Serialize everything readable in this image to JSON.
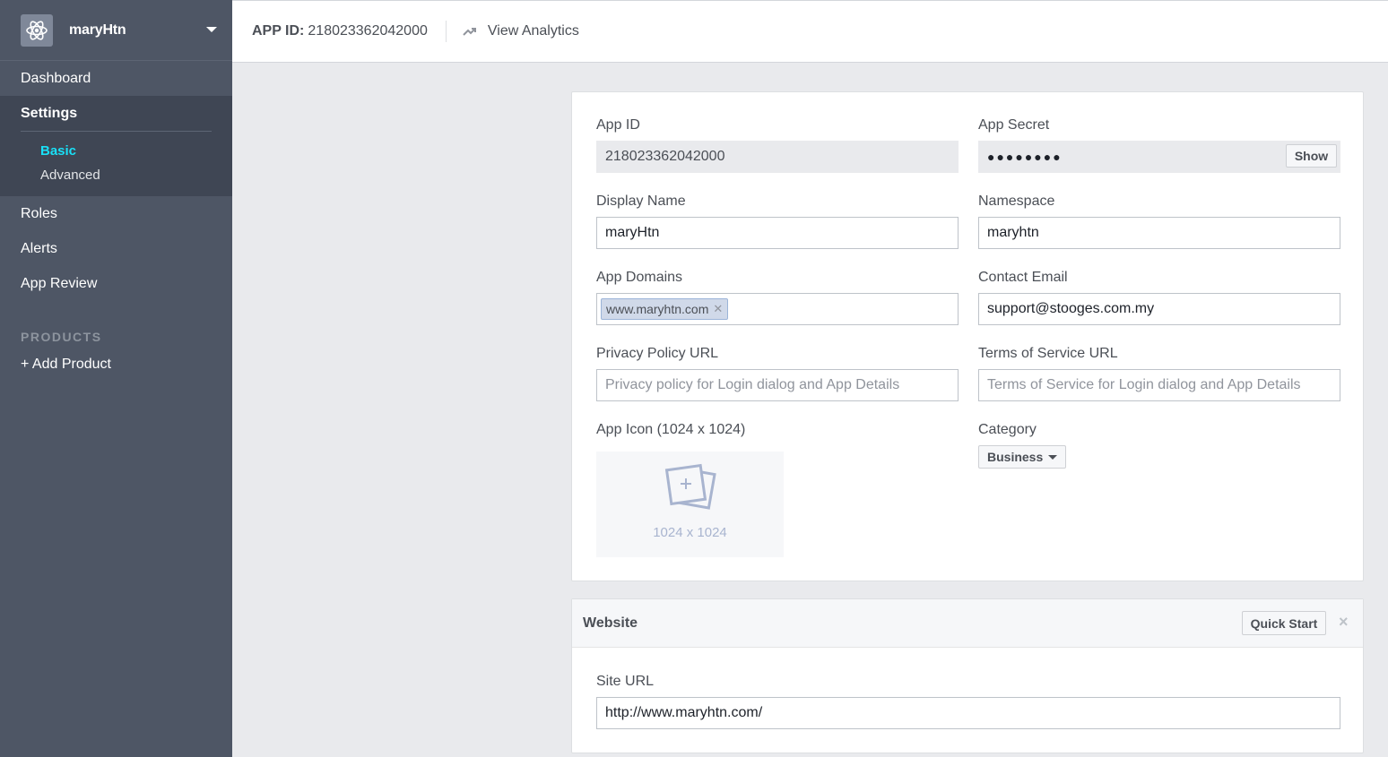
{
  "app": {
    "name": "maryHtn"
  },
  "sidebar": {
    "items": [
      {
        "label": "Dashboard"
      },
      {
        "label": "Settings"
      },
      {
        "label": "Roles"
      },
      {
        "label": "Alerts"
      },
      {
        "label": "App Review"
      }
    ],
    "settings_sub": [
      {
        "label": "Basic",
        "active": true
      },
      {
        "label": "Advanced",
        "active": false
      }
    ],
    "products_heading": "PRODUCTS",
    "add_product": "+ Add Product"
  },
  "topbar": {
    "appid_label": "APP ID:",
    "appid_value": "218023362042000",
    "analytics_label": "View Analytics"
  },
  "basic": {
    "app_id_label": "App ID",
    "app_id_value": "218023362042000",
    "app_secret_label": "App Secret",
    "app_secret_value": "●●●●●●●●",
    "show_label": "Show",
    "display_name_label": "Display Name",
    "display_name_value": "maryHtn",
    "namespace_label": "Namespace",
    "namespace_value": "maryhtn",
    "app_domains_label": "App Domains",
    "app_domain_tag": "www.maryhtn.com",
    "contact_email_label": "Contact Email",
    "contact_email_value": "support@stooges.com.my",
    "privacy_label": "Privacy Policy URL",
    "privacy_placeholder": "Privacy policy for Login dialog and App Details",
    "tos_label": "Terms of Service URL",
    "tos_placeholder": "Terms of Service for Login dialog and App Details",
    "icon_label": "App Icon (1024 x 1024)",
    "icon_size_text": "1024 x 1024",
    "category_label": "Category",
    "category_value": "Business"
  },
  "website": {
    "title": "Website",
    "quick_start": "Quick Start",
    "close": "×",
    "site_url_label": "Site URL",
    "site_url_value": "http://www.maryhtn.com/"
  },
  "colors": {
    "sidebar": "#4e5665",
    "active_sub": "#19e0f7",
    "background": "#e9eaed"
  }
}
